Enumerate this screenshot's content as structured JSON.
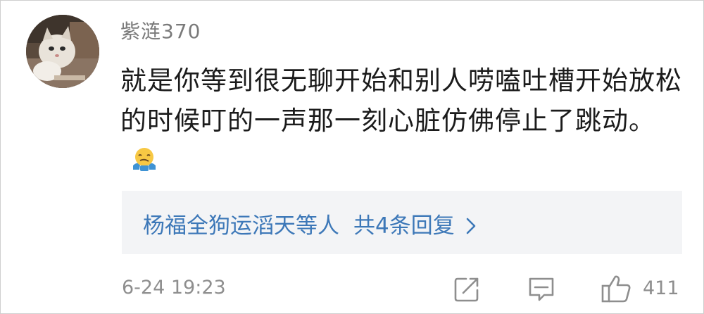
{
  "comment": {
    "username": "紫涟370",
    "text": "就是你等到很无聊开始和别人唠嗑吐槽开始放松的时候叮的一声那一刻心脏仿佛停止了跳动。",
    "emoji_icon": "shrugging-face-emoji",
    "replies": {
      "names": "杨福全狗运滔天等人",
      "count_label": "共4条回复"
    },
    "date": "6-24 19:23",
    "like_count": "411"
  },
  "colors": {
    "link": "#3d78b8",
    "muted": "#8e8e8e",
    "text": "#1b1b1b",
    "reply_bg": "#f3f4f6"
  }
}
